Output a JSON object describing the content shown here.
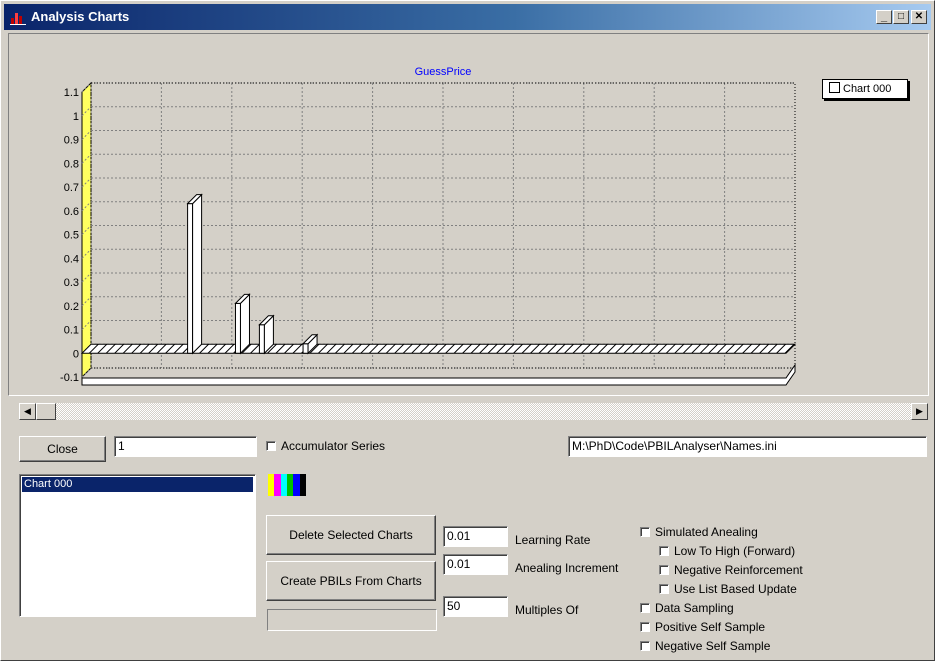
{
  "window": {
    "title": "Analysis Charts",
    "minimize": "_",
    "maximize": "□",
    "close": "✕"
  },
  "chart_data": {
    "type": "bar",
    "title": "GuessPrice",
    "xlabel": "",
    "ylabel": "",
    "xlim": [
      0,
      500
    ],
    "ylim": [
      -0.1,
      1.1
    ],
    "grid": true,
    "legend_placement": "top-right",
    "x_ticks": [
      0,
      50,
      100,
      150,
      200,
      250,
      300,
      350,
      400,
      450
    ],
    "y_ticks": [
      "1.1",
      "1",
      "0.9",
      "0.8",
      "0.7",
      "0.6",
      "0.5",
      "0.4",
      "0.3",
      "0.2",
      "0.1",
      "0",
      "-0.1"
    ],
    "series": [
      {
        "name": "Chart 000",
        "bars": [
          {
            "x": 75,
            "y": 0.63
          },
          {
            "x": 109,
            "y": 0.21
          },
          {
            "x": 126,
            "y": 0.12
          },
          {
            "x": 157,
            "y": 0.04
          }
        ]
      }
    ]
  },
  "legend": {
    "entry": "Chart 000"
  },
  "controls": {
    "close_label": "Close",
    "index_value": "1",
    "accumulator_label": "Accumulator Series",
    "path_value": "M:\\PhD\\Code\\PBILAnalyser\\Names.ini",
    "list_items": [
      "Chart 000"
    ],
    "palette": [
      "#ffff00",
      "#ff00ff",
      "#00ffff",
      "#00c000",
      "#0000ff",
      "#000000"
    ],
    "delete_label": "Delete Selected Charts",
    "create_label": "Create PBILs From Charts",
    "learning_rate_value": "0.01",
    "learning_rate_label": "Learning Rate",
    "anealing_inc_value": "0.01",
    "anealing_inc_label": "Anealing Increment",
    "multiples_value": "50",
    "multiples_label": "Multiples Of",
    "checks": {
      "simulated_anealing": "Simulated Anealing",
      "low_to_high": "Low To High (Forward)",
      "negative_reinforcement": "Negative Reinforcement",
      "use_list_update": "Use List Based Update",
      "data_sampling": "Data Sampling",
      "positive_self_sample": "Positive Self Sample",
      "negative_self_sample": "Negative Self Sample"
    }
  }
}
